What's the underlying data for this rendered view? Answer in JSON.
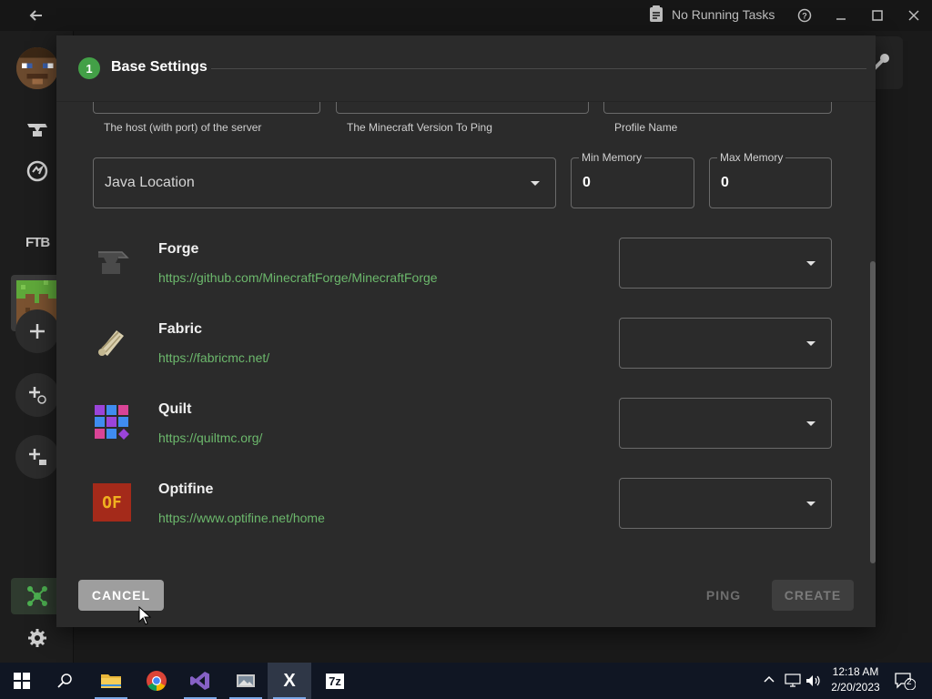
{
  "titlebar": {
    "tasks_label": "No Running Tasks",
    "icons": [
      "back-arrow-icon",
      "clipboard-icon",
      "help-icon",
      "minimize-icon",
      "maximize-icon",
      "close-icon"
    ]
  },
  "sidebar": {
    "ftb_label": "FTB",
    "icons": [
      "avatar",
      "anvil-icon",
      "curseforge-icon",
      "ftb-icon",
      "grass-block-icon",
      "add-icon",
      "add-browse-icon",
      "add-folder-icon",
      "modpack-icon",
      "settings-icon"
    ]
  },
  "modal": {
    "step_number": "1",
    "step_title": "Base Settings",
    "fields": {
      "host_helper": "The host (with port) of the server",
      "version_helper": "The Minecraft Version To Ping",
      "profile_helper": "Profile Name",
      "java_label": "Java Location",
      "min_memory_label": "Min Memory",
      "min_memory_value": "0",
      "max_memory_label": "Max Memory",
      "max_memory_value": "0"
    },
    "loaders": [
      {
        "name": "Forge",
        "url": "https://github.com/MinecraftForge/MinecraftForge",
        "icon": "forge-anvil-icon"
      },
      {
        "name": "Fabric",
        "url": "https://fabricmc.net/",
        "icon": "fabric-scroll-icon"
      },
      {
        "name": "Quilt",
        "url": "https://quiltmc.org/",
        "icon": "quilt-patch-icon"
      },
      {
        "name": "Optifine",
        "url": "https://www.optifine.net/home",
        "icon": "optifine-logo-icon",
        "icon_text": "OF"
      }
    ],
    "buttons": {
      "cancel": "CANCEL",
      "ping": "PING",
      "create": "CREATE"
    }
  },
  "taskbar": {
    "apps": [
      "windows-start-icon",
      "search-icon",
      "file-explorer-icon",
      "chrome-icon",
      "visual-studio-icon",
      "app-icon",
      "x-app-icon",
      "7zip-icon"
    ],
    "sevenzip_label": "7z",
    "x_label": "X",
    "time": "12:18 AM",
    "date": "2/20/2023",
    "notification_count": "2"
  },
  "colors": {
    "accent_green": "#43a047",
    "link_green": "#6cb86c",
    "modal_bg": "#2b2b2b",
    "cancel_bg": "#9e9e9e"
  }
}
